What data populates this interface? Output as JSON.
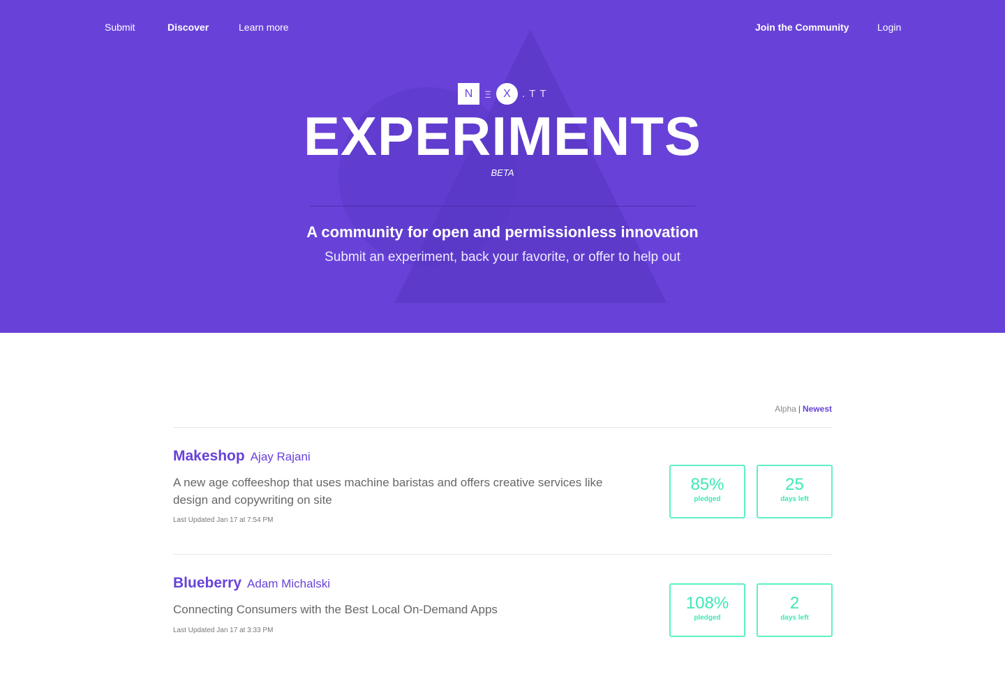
{
  "nav": {
    "left": [
      {
        "label": "Submit"
      },
      {
        "label": "Discover"
      },
      {
        "label": "Learn more"
      }
    ],
    "right": [
      {
        "label": "Join the Community"
      },
      {
        "label": "Login"
      }
    ]
  },
  "brand": {
    "logo_n": "N",
    "logo_e": "Ξ",
    "logo_x": "X",
    "logo_tail": ".TT",
    "title": "EXPERIMENTS",
    "badge": "BETA"
  },
  "hero": {
    "headline": "A community for open and permissionless innovation",
    "subline": "Submit an experiment, back your favorite, or offer to help out"
  },
  "sort": {
    "options": [
      "Alpha",
      "Newest"
    ],
    "separator": "|",
    "selected": "Newest"
  },
  "experiments": [
    {
      "name": "Makeshop",
      "author": "Ajay Rajani",
      "description": "A new age coffeeshop that uses machine baristas and offers creative services like design and copywriting on site",
      "updated": "Last Updated Jan 17 at 7:54 PM",
      "pledged": "85%",
      "pledged_label": "pledged",
      "days": "25",
      "days_label": "days left"
    },
    {
      "name": "Blueberry",
      "author": "Adam Michalski",
      "description": "Connecting Consumers with the Best Local On-Demand Apps",
      "updated": "Last Updated Jan 17 at 3:33 PM",
      "pledged": "108%",
      "pledged_label": "pledged",
      "days": "2",
      "days_label": "days left"
    }
  ],
  "colors": {
    "hero_bg": "#6842d8",
    "accent": "#6842d8",
    "stat_green": "#3ee8b6",
    "stat_border": "#5ef0c6"
  }
}
